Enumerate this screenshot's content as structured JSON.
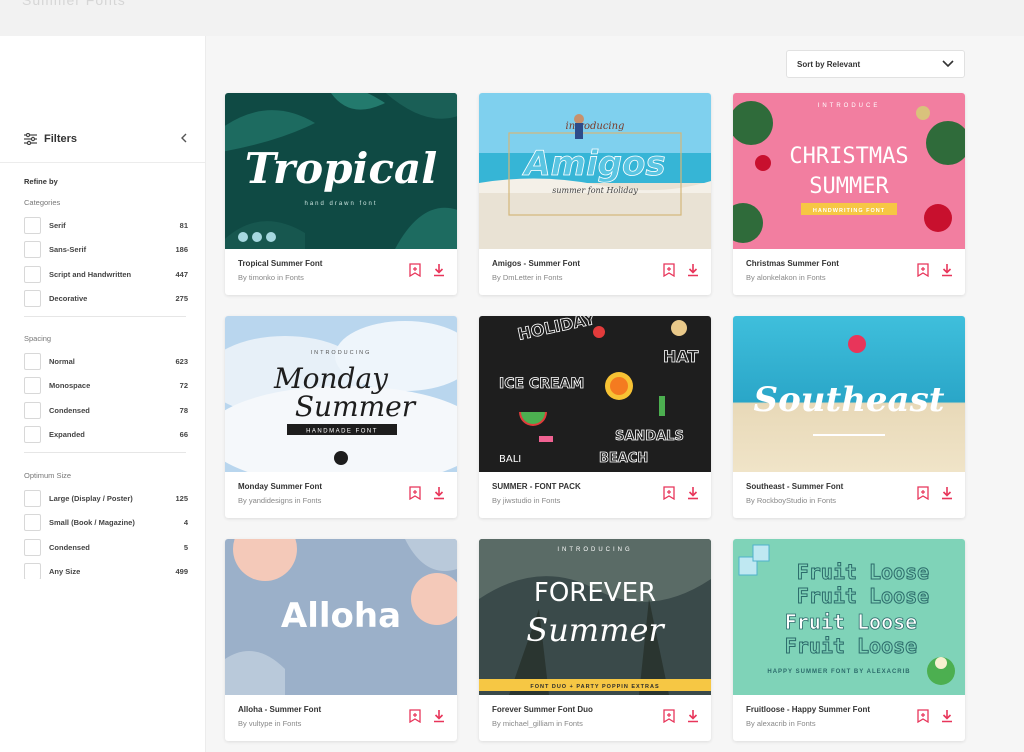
{
  "colors": {
    "accent": "#e8355a",
    "text": "#333333",
    "muted": "#888888"
  },
  "header": {
    "ghost_text": "Summer Fonts"
  },
  "sidebar": {
    "title": "Filters",
    "collapse_icon": "chevron-left-icon",
    "refine_label": "Refine by",
    "groups": [
      {
        "title": "Categories",
        "options": [
          {
            "label": "Serif",
            "count": "81"
          },
          {
            "label": "Sans-Serif",
            "count": "186"
          },
          {
            "label": "Script and Handwritten",
            "count": "447"
          },
          {
            "label": "Decorative",
            "count": "275"
          }
        ]
      },
      {
        "title": "Spacing",
        "options": [
          {
            "label": "Normal",
            "count": "623"
          },
          {
            "label": "Monospace",
            "count": "72"
          },
          {
            "label": "Condensed",
            "count": "78"
          },
          {
            "label": "Expanded",
            "count": "66"
          }
        ]
      },
      {
        "title": "Optimum Size",
        "options": [
          {
            "label": "Large (Display / Poster)",
            "count": "125"
          },
          {
            "label": "Small (Book / Magazine)",
            "count": "4"
          },
          {
            "label": "Condensed",
            "count": "5"
          },
          {
            "label": "Any Size",
            "count": "499"
          }
        ]
      }
    ]
  },
  "sort": {
    "label": "Sort by Relevant"
  },
  "cards": [
    {
      "title": "Tropical Summer Font",
      "by": "By timonko in Fonts",
      "thumb_text": "Tropical",
      "thumb_sub": "hand drawn font"
    },
    {
      "title": "Amigos - Summer Font",
      "by": "By DmLetter in Fonts",
      "thumb_text": "Amigos",
      "thumb_sub": "summer font  Holiday",
      "thumb_top": "introducing"
    },
    {
      "title": "Christmas Summer Font",
      "by": "By alonkelakon in Fonts",
      "thumb_text": "CHRISTMAS",
      "thumb_text2": "SUMMER",
      "thumb_sub": "HANDWRITING FONT",
      "thumb_top": "INTRODUCE"
    },
    {
      "title": "Monday Summer Font",
      "by": "By yandidesigns in Fonts",
      "thumb_text": "Monday",
      "thumb_text2": "Summer",
      "thumb_sub": "HANDMADE FONT",
      "thumb_top": "INTRODUCING"
    },
    {
      "title": "SUMMER - FONT PACK",
      "by": "By jiwstudio in Fonts",
      "thumb_text": "HOLIDAY",
      "thumb_text2": "ICE CREAM",
      "thumb_text3": "SANDALS",
      "thumb_text4": "BEACH",
      "thumb_text5": "HAT"
    },
    {
      "title": "Southeast - Summer Font",
      "by": "By RockboyStudio in Fonts",
      "thumb_text": "Southeast"
    },
    {
      "title": "Alloha - Summer Font",
      "by": "By vultype in Fonts",
      "thumb_text": "Alloha"
    },
    {
      "title": "Forever Summer Font Duo",
      "by": "By michael_gilliam in Fonts",
      "thumb_text": "FOREVER",
      "thumb_text2": "Summer",
      "thumb_sub": "FONT DUO + PARTY POPPIN EXTRAS",
      "thumb_top": "INTRODUCING"
    },
    {
      "title": "Fruitloose - Happy Summer Font",
      "by": "By alexacrib in Fonts",
      "thumb_text": "Fruit Loose",
      "thumb_sub": "HAPPY SUMMER FONT BY ALEXACRIB"
    }
  ]
}
